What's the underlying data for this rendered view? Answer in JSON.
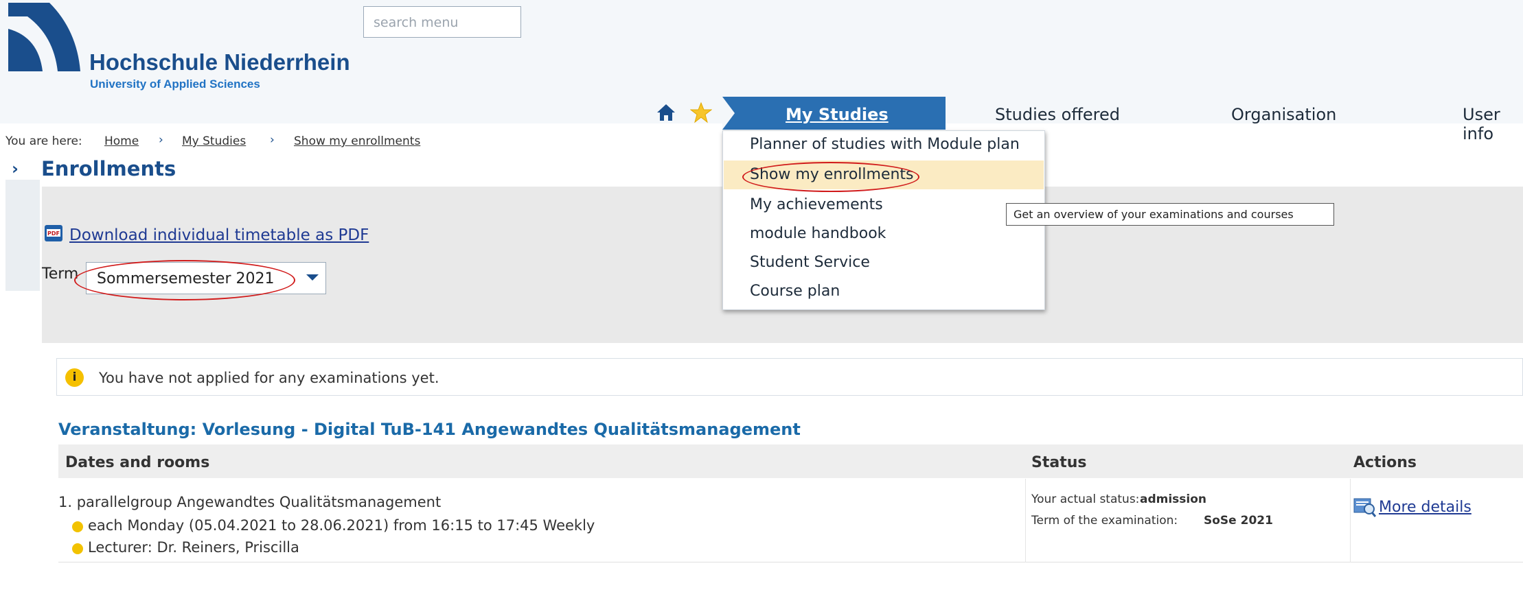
{
  "header": {
    "brand_name": "Hochschule Niederrhein",
    "brand_subtitle": "University of Applied Sciences",
    "search_placeholder": "search menu"
  },
  "nav": {
    "items": [
      "My Studies",
      "Studies offered",
      "Organisation",
      "User info"
    ],
    "active_index": 0,
    "accent_color": "#2a6fb2"
  },
  "dropdown": {
    "items": [
      "Planner of studies with Module plan",
      "Show my enrollments",
      "My achievements",
      "module handbook",
      "Student Service",
      "Course plan"
    ],
    "highlighted_index": 1,
    "tooltip": "Get an overview of your examinations and courses"
  },
  "breadcrumb": {
    "prefix": "You are here:",
    "items": [
      "Home",
      "My Studies",
      "Show my enrollments"
    ]
  },
  "page": {
    "title": "Enrollments",
    "pdf_link": "Download individual timetable as PDF",
    "term_label": "Term",
    "term_value": "Sommersemester 2021"
  },
  "info": {
    "message": "You have not applied for any examinations yet."
  },
  "event": {
    "title": "Veranstaltung: Vorlesung - Digital TuB-141 Angewandtes Qualitätsmanagement",
    "columns": [
      "Dates and rooms",
      "Status",
      "Actions"
    ],
    "group": "1. parallelgroup Angewandtes Qualitätsmanagement",
    "schedule": "each Monday (05.04.2021 to 28.06.2021) from 16:15 to 17:45 Weekly",
    "lecturer": "Lecturer: Dr. Reiners, Priscilla",
    "status_label": "Your actual status:",
    "status_value": "admission",
    "exam_term_label": "Term of the examination:",
    "exam_term_value": "SoSe 2021",
    "action": "More details"
  }
}
